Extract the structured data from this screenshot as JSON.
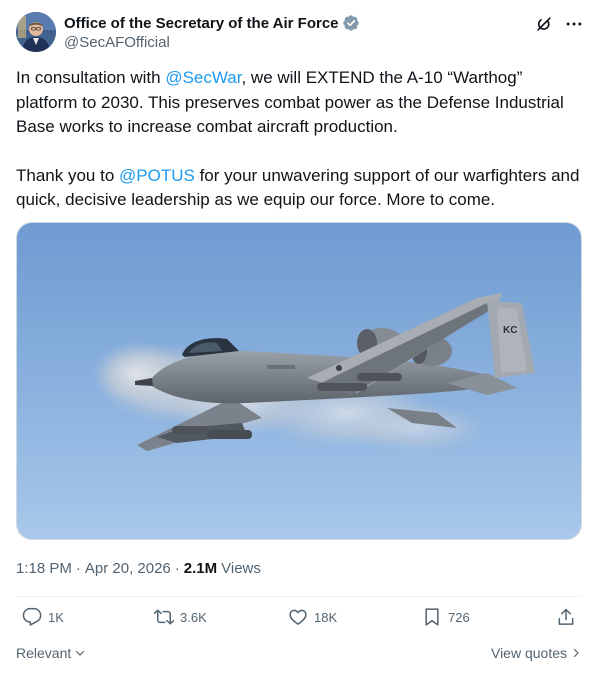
{
  "account": {
    "display_name": "Office of the Secretary of the Air Force",
    "handle": "@SecAFOfficial",
    "verified": true,
    "avatar_icon": "profile-photo"
  },
  "tweet": {
    "p1_before": "In consultation with ",
    "p1_mention": "@SecWar",
    "p1_after": ", we will EXTEND the A-10 “Warthog” platform to 2030. This preserves combat power as the Defense Industrial Base works to increase combat aircraft production.",
    "p2_before": "Thank you to ",
    "p2_mention": "@POTUS",
    "p2_after": " for your unwavering support of our warfighters and quick, decisive leadership as we equip our force. More to come."
  },
  "media": {
    "tail_code": "KC",
    "alt": ""
  },
  "meta": {
    "time": "1:18 PM",
    "date": "Apr 20, 2026",
    "views_count": "2.1M",
    "views_label": "Views"
  },
  "actions": {
    "replies": "1K",
    "reposts": "3.6K",
    "likes": "18K",
    "bookmarks": "726"
  },
  "footer": {
    "sort_label": "Relevant",
    "quotes_label": "View quotes"
  },
  "colors": {
    "link": "#1d9bf0",
    "text": "#0f1419",
    "muted": "#536471",
    "verified": "#829aab"
  }
}
